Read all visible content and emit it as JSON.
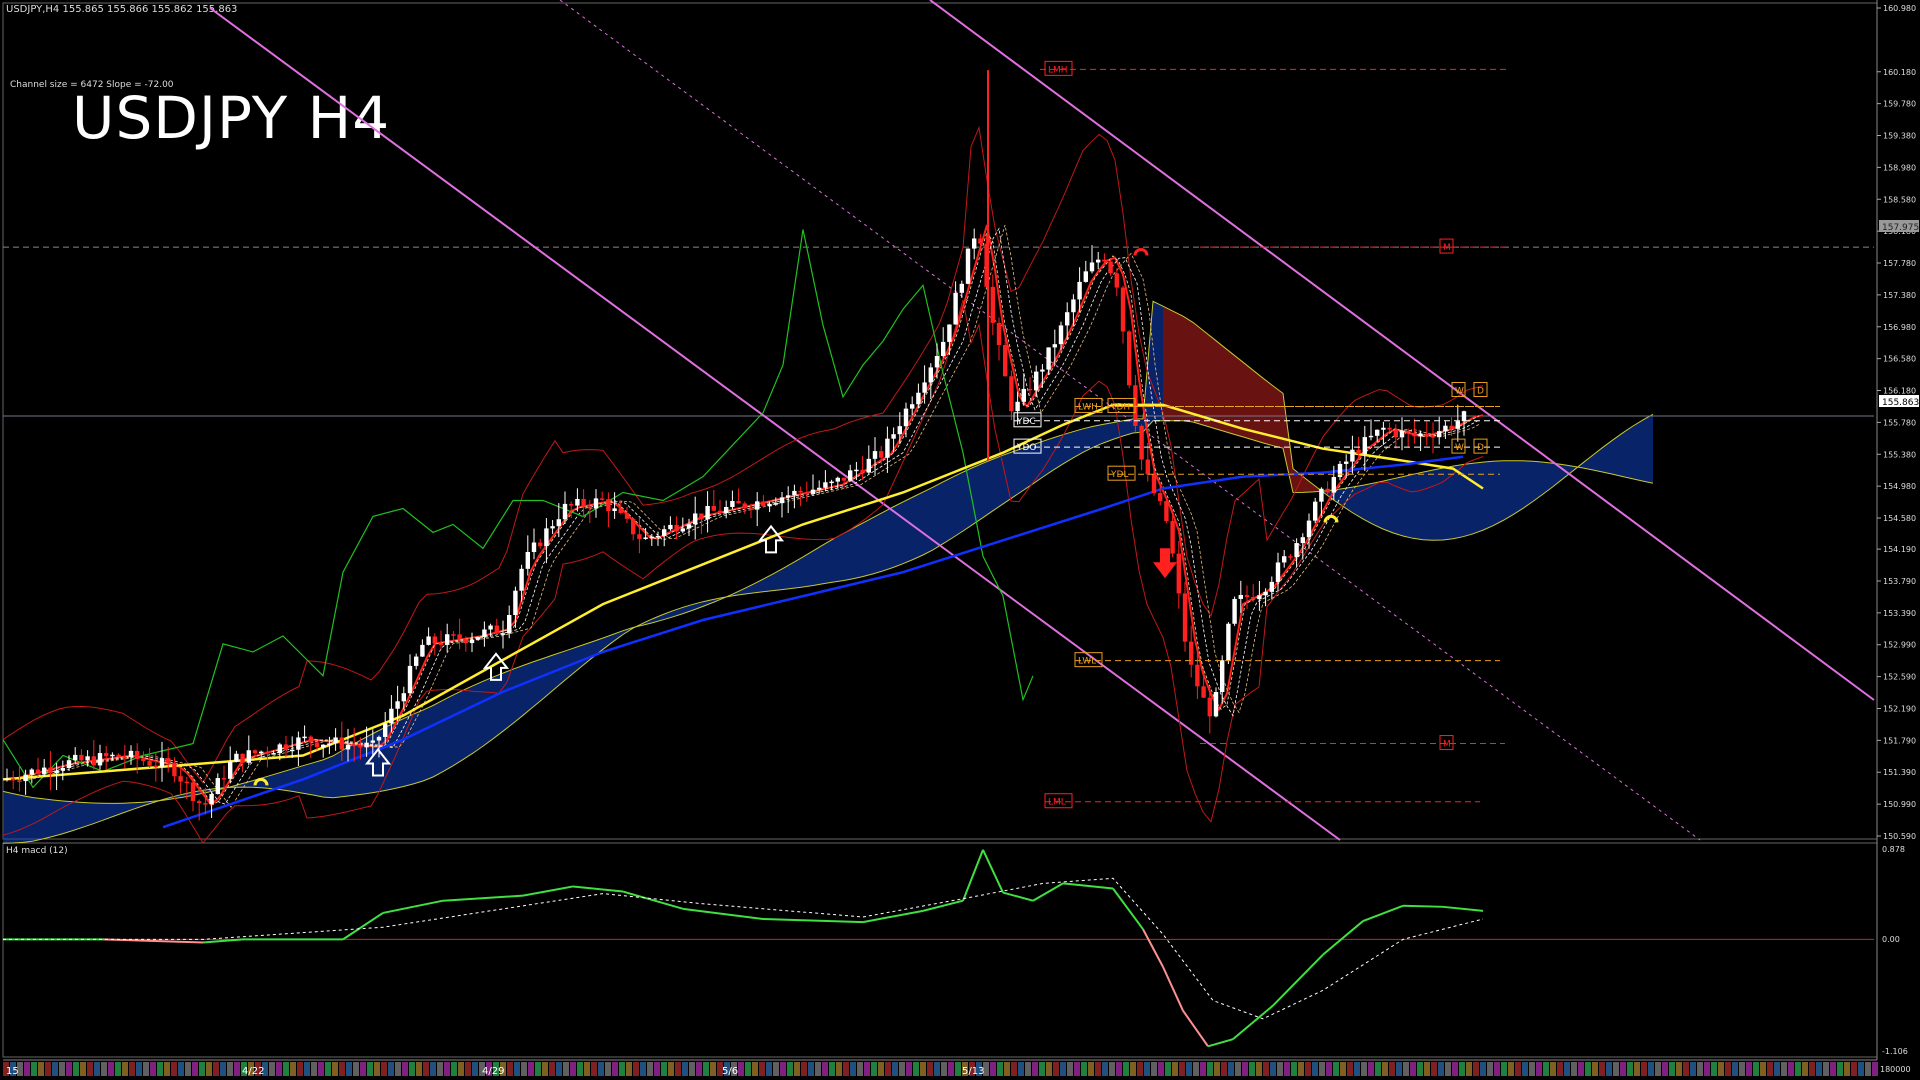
{
  "header": {
    "instrument_line": "USDJPY,H4  155.865 155.866 155.862 155.863",
    "channel_info": "Channel size = 6472 Slope = -72.00",
    "title": "USDJPY H4"
  },
  "macd_panel": {
    "label": "H4  macd (12)",
    "ticks": [
      "0.878",
      "0.00",
      "-1.106"
    ],
    "bottom_label": "180000"
  },
  "chart_data": {
    "type": "candlestick",
    "title": "USDJPY H4",
    "price_axis": {
      "ylim": [
        150.59,
        160.98
      ],
      "ticks": [
        "160.980",
        "160.180",
        "159.780",
        "159.380",
        "158.980",
        "158.580",
        "158.180",
        "157.780",
        "157.380",
        "156.980",
        "156.580",
        "156.180",
        "155.780",
        "155.380",
        "154.980",
        "154.580",
        "154.190",
        "153.790",
        "153.390",
        "152.990",
        "152.590",
        "152.190",
        "151.790",
        "151.390",
        "150.990",
        "150.590"
      ],
      "current_price": "155.863",
      "marked_price": "157.975"
    },
    "date_axis": {
      "labels": [
        "15",
        "4/22",
        "4/29",
        "5/6",
        "5/13"
      ]
    },
    "levels": [
      {
        "label": "LMH",
        "value": 160.21,
        "color": "#ff2020"
      },
      {
        "label": "LWH",
        "value": 155.98,
        "color": "#e8a020"
      },
      {
        "label": "YDH",
        "value": 155.98,
        "color": "#e8a020"
      },
      {
        "label": "YDC",
        "value": 155.8,
        "color": "#ffffff"
      },
      {
        "label": "YDO",
        "value": 155.47,
        "color": "#ffffff"
      },
      {
        "label": "YDL",
        "value": 155.13,
        "color": "#e8a020"
      },
      {
        "label": "LWL",
        "value": 152.79,
        "color": "#e8a020"
      },
      {
        "label": "LML",
        "value": 151.02,
        "color": "#ff2020"
      },
      {
        "label": "M",
        "value": 157.98,
        "color": "#ff2020"
      },
      {
        "label": "M",
        "value": 151.75,
        "color": "#ff2020"
      },
      {
        "label": "W",
        "value": 156.18,
        "color": "#e8a020"
      },
      {
        "label": "D",
        "value": 156.18,
        "color": "#e8a020"
      },
      {
        "label": "W",
        "value": 155.47,
        "color": "#e8a020"
      },
      {
        "label": "D",
        "value": 155.47,
        "color": "#e8a020"
      }
    ],
    "price_path": [
      [
        0,
        151.3
      ],
      [
        60,
        151.5
      ],
      [
        120,
        151.6
      ],
      [
        170,
        151.45
      ],
      [
        200,
        150.95
      ],
      [
        230,
        151.55
      ],
      [
        300,
        151.8
      ],
      [
        370,
        151.7
      ],
      [
        395,
        152.3
      ],
      [
        420,
        153.0
      ],
      [
        470,
        153.1
      ],
      [
        500,
        153.2
      ],
      [
        520,
        154.0
      ],
      [
        560,
        154.7
      ],
      [
        600,
        154.8
      ],
      [
        640,
        154.3
      ],
      [
        690,
        154.6
      ],
      [
        760,
        154.8
      ],
      [
        830,
        155.0
      ],
      [
        880,
        155.4
      ],
      [
        940,
        156.8
      ],
      [
        975,
        158.3
      ],
      [
        990,
        157.0
      ],
      [
        1010,
        155.9
      ],
      [
        1040,
        156.5
      ],
      [
        1060,
        157.0
      ],
      [
        1080,
        157.6
      ],
      [
        1100,
        157.9
      ],
      [
        1115,
        157.5
      ],
      [
        1125,
        156.4
      ],
      [
        1140,
        155.2
      ],
      [
        1165,
        154.5
      ],
      [
        1185,
        152.8
      ],
      [
        1200,
        152.3
      ],
      [
        1210,
        152.1
      ],
      [
        1230,
        153.5
      ],
      [
        1260,
        153.7
      ],
      [
        1290,
        154.2
      ],
      [
        1320,
        154.9
      ],
      [
        1350,
        155.4
      ],
      [
        1380,
        155.7
      ],
      [
        1410,
        155.6
      ],
      [
        1440,
        155.7
      ],
      [
        1465,
        155.87
      ]
    ],
    "yellow_ma": [
      [
        0,
        151.3
      ],
      [
        150,
        151.45
      ],
      [
        300,
        151.6
      ],
      [
        400,
        152.1
      ],
      [
        500,
        152.8
      ],
      [
        600,
        153.5
      ],
      [
        700,
        154.0
      ],
      [
        800,
        154.5
      ],
      [
        900,
        154.9
      ],
      [
        1000,
        155.4
      ],
      [
        1060,
        155.75
      ],
      [
        1110,
        156.0
      ],
      [
        1160,
        156.0
      ],
      [
        1240,
        155.7
      ],
      [
        1320,
        155.45
      ],
      [
        1400,
        155.3
      ],
      [
        1450,
        155.2
      ],
      [
        1480,
        154.95
      ]
    ],
    "blue_ma": [
      [
        160,
        150.7
      ],
      [
        300,
        151.3
      ],
      [
        400,
        151.8
      ],
      [
        500,
        152.4
      ],
      [
        600,
        152.9
      ],
      [
        700,
        153.3
      ],
      [
        800,
        153.6
      ],
      [
        900,
        153.9
      ],
      [
        1000,
        154.3
      ],
      [
        1100,
        154.7
      ],
      [
        1160,
        154.95
      ],
      [
        1240,
        155.1
      ],
      [
        1320,
        155.15
      ],
      [
        1400,
        155.25
      ],
      [
        1460,
        155.35
      ]
    ],
    "green_lagging": [
      [
        0,
        151.8
      ],
      [
        30,
        151.2
      ],
      [
        60,
        151.6
      ],
      [
        100,
        151.4
      ],
      [
        140,
        151.6
      ],
      [
        190,
        151.75
      ],
      [
        220,
        153.0
      ],
      [
        250,
        152.9
      ],
      [
        280,
        153.1
      ],
      [
        320,
        152.6
      ],
      [
        340,
        153.9
      ],
      [
        370,
        154.6
      ],
      [
        400,
        154.7
      ],
      [
        430,
        154.4
      ],
      [
        450,
        154.5
      ],
      [
        480,
        154.2
      ],
      [
        510,
        154.8
      ],
      [
        540,
        154.8
      ],
      [
        580,
        154.6
      ],
      [
        620,
        154.9
      ],
      [
        660,
        154.8
      ],
      [
        700,
        155.1
      ],
      [
        730,
        155.5
      ],
      [
        760,
        155.9
      ],
      [
        780,
        156.5
      ],
      [
        800,
        158.2
      ],
      [
        820,
        157.0
      ],
      [
        840,
        156.1
      ],
      [
        860,
        156.5
      ],
      [
        880,
        156.8
      ],
      [
        900,
        157.2
      ],
      [
        920,
        157.5
      ],
      [
        940,
        156.4
      ],
      [
        960,
        155.4
      ],
      [
        980,
        154.1
      ],
      [
        1000,
        153.6
      ],
      [
        1020,
        152.3
      ],
      [
        1030,
        152.6
      ]
    ],
    "macd": {
      "ylim": [
        -1.106,
        0.878
      ],
      "main": [
        [
          0,
          0.0
        ],
        [
          100,
          0.0
        ],
        [
          200,
          -0.03
        ],
        [
          240,
          0.0
        ],
        [
          340,
          0.0
        ],
        [
          380,
          0.26
        ],
        [
          440,
          0.38
        ],
        [
          520,
          0.43
        ],
        [
          570,
          0.52
        ],
        [
          620,
          0.47
        ],
        [
          680,
          0.3
        ],
        [
          760,
          0.2
        ],
        [
          860,
          0.17
        ],
        [
          920,
          0.28
        ],
        [
          960,
          0.38
        ],
        [
          980,
          0.88
        ],
        [
          1000,
          0.46
        ],
        [
          1030,
          0.38
        ],
        [
          1060,
          0.55
        ],
        [
          1110,
          0.5
        ],
        [
          1140,
          0.1
        ],
        [
          1160,
          -0.27
        ],
        [
          1180,
          -0.7
        ],
        [
          1205,
          -1.05
        ],
        [
          1230,
          -0.98
        ],
        [
          1270,
          -0.65
        ],
        [
          1320,
          -0.15
        ],
        [
          1360,
          0.18
        ],
        [
          1400,
          0.33
        ],
        [
          1440,
          0.32
        ],
        [
          1480,
          0.28
        ]
      ],
      "signal": [
        [
          0,
          0.0
        ],
        [
          200,
          0.0
        ],
        [
          380,
          0.12
        ],
        [
          600,
          0.45
        ],
        [
          700,
          0.35
        ],
        [
          860,
          0.22
        ],
        [
          960,
          0.4
        ],
        [
          1040,
          0.55
        ],
        [
          1110,
          0.6
        ],
        [
          1160,
          0.05
        ],
        [
          1210,
          -0.6
        ],
        [
          1260,
          -0.78
        ],
        [
          1320,
          -0.5
        ],
        [
          1400,
          0.0
        ],
        [
          1480,
          0.2
        ]
      ]
    }
  },
  "colors": {
    "background": "#000000",
    "grid_dash": "#888888",
    "channel": "#e070e0",
    "bull": "#ffffff",
    "bear": "#ff2020",
    "ma_yellow": "#ffee30",
    "ma_blue": "#1030ff",
    "macd_main": "#40e040",
    "macd_neg": "#ff9090",
    "kumo_blue": "#1040c0",
    "kumo_red": "#c02020"
  }
}
